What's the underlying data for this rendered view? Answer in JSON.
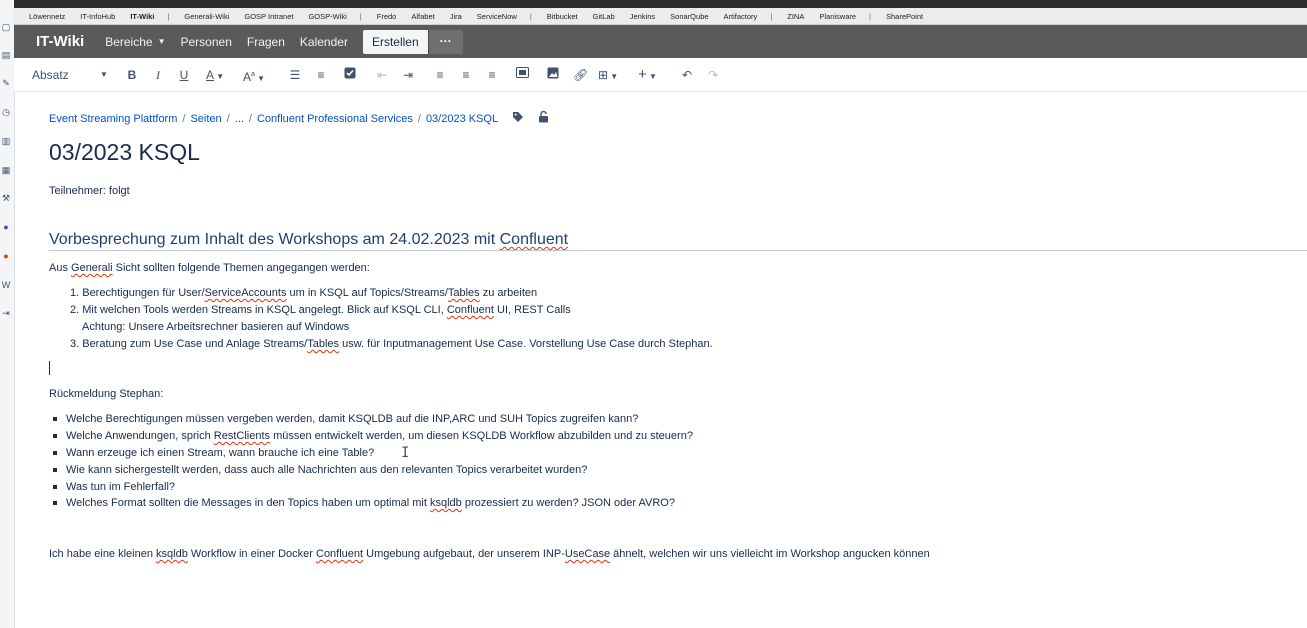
{
  "bookmarks": [
    "Löwennetz",
    "IT-InfoHub",
    "IT-Wiki",
    "|",
    "Generali-Wiki",
    "GOSP Intranet",
    "GOSP-Wiki",
    "|",
    "Fredo",
    "Alfabet",
    "Jira",
    "ServiceNow",
    "|",
    "Bitbucket",
    "GitLab",
    "Jenkins",
    "SonarQube",
    "Artifactory",
    "|",
    "ZINA",
    "Planisware",
    "|",
    "SharePoint"
  ],
  "navbar": {
    "logo": "IT-Wiki",
    "items": [
      "Bereiche",
      "Personen",
      "Fragen",
      "Kalender"
    ],
    "create_label": "Erstellen",
    "more_label": "···"
  },
  "toolbar": {
    "paragraph_style": "Absatz",
    "icons": [
      "bold-icon",
      "italic-icon",
      "underline-icon",
      "text-color-icon",
      "text-style-icon",
      "bullet-list-icon",
      "numbered-list-icon",
      "task-list-icon",
      "outdent-icon",
      "indent-icon",
      "align-left-icon",
      "align-center-icon",
      "align-right-icon",
      "layout-icon",
      "image-icon",
      "link-icon",
      "table-icon",
      "insert-icon",
      "undo-icon",
      "redo-icon"
    ]
  },
  "breadcrumb": [
    "Event Streaming Plattform",
    "Seiten",
    "...",
    "Confluent Professional Services",
    "03/2023 KSQL"
  ],
  "page": {
    "title": "03/2023 KSQL",
    "participants": "Teilnehmer: folgt",
    "heading": "Vorbesprechung zum Inhalt des Workshops am 24.02.2023 mit Confluent",
    "intro": "Aus Generali Sicht sollten folgende Themen angegangen werden:",
    "ordered": [
      "1. Berechtigungen für User/ServiceAccounts um in KSQL auf Topics/Streams/Tables zu arbeiten",
      "2. Mit welchen Tools werden Streams in KSQL angelegt. Blick auf KSQL CLI, Confluent UI, REST Calls",
      "Achtung: Unsere Arbeitsrechner basieren auf Windows",
      "3. Beratung zum Use Case und Anlage Streams/Tables usw. für Inputmanagement Use Case. Vorstellung Use Case durch Stephan."
    ],
    "feedback_label": "Rückmeldung Stephan:",
    "bullets": [
      "Welche Berechtigungen müssen vergeben werden, damit KSQLDB auf die INP,ARC und SUH Topics zugreifen kann?",
      "Welche Anwendungen, sprich RestClients müssen entwickelt werden, um diesen KSQLDB Workflow abzubilden und zu steuern?",
      "Wann erzeuge ich einen Stream, wann brauche ich eine Table?",
      "Wie kann sichergestellt werden, dass auch alle Nachrichten aus den relevanten Topics verarbeitet wurden?",
      "Was tun im Fehlerfall?",
      "Welches Format sollten die Messages in den Topics haben um optimal mit ksqldb prozessiert zu werden? JSON oder AVRO?"
    ],
    "closing": "Ich habe eine kleinen ksqldb Workflow in einer Docker Confluent Umgebung aufgebaut, der unserem INP-UseCase ähnelt, welchen wir uns vielleicht im Workshop angucken können"
  }
}
